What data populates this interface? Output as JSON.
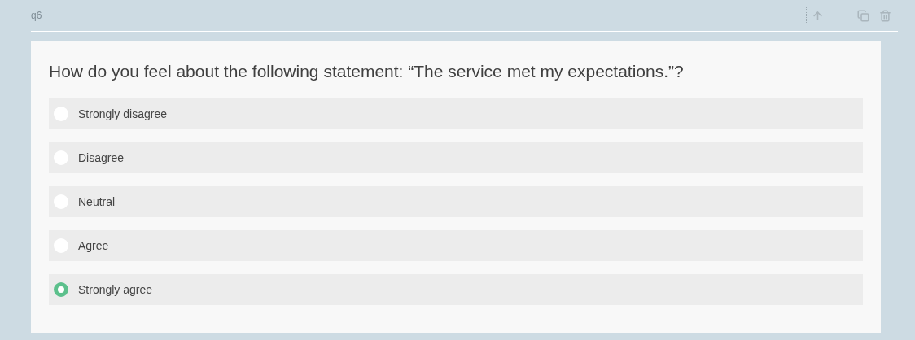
{
  "question_id": "q6",
  "question": "How do you feel about the following statement: “The service met my expectations.”?",
  "options": [
    {
      "label": "Strongly disagree",
      "selected": false
    },
    {
      "label": "Disagree",
      "selected": false
    },
    {
      "label": "Neutral",
      "selected": false
    },
    {
      "label": "Agree",
      "selected": false
    },
    {
      "label": "Strongly agree",
      "selected": true
    }
  ]
}
